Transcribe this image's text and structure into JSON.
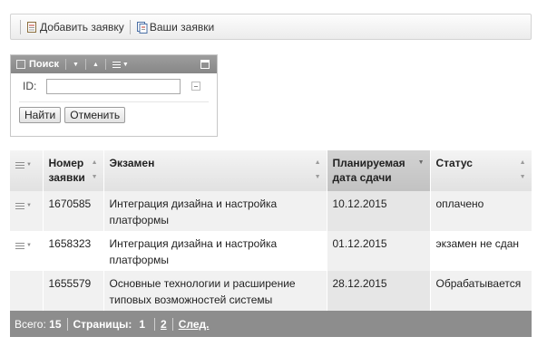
{
  "toolbar": {
    "add_label": "Добавить заявку",
    "mine_label": "Ваши заявки"
  },
  "search": {
    "title": "Поиск",
    "id_label": "ID:",
    "id_value": "",
    "find_label": "Найти",
    "cancel_label": "Отменить"
  },
  "grid": {
    "columns": {
      "number": "Номер заявки",
      "exam": "Экзамен",
      "date": "Планируемая дата сдачи",
      "status": "Статус"
    },
    "rows": [
      {
        "number": "1670585",
        "exam": "Интеграция дизайна и настройка платформы",
        "date": "10.12.2015",
        "status": "оплачено"
      },
      {
        "number": "1658323",
        "exam": "Интеграция дизайна и настройка платформы",
        "date": "01.12.2015",
        "status": "экзамен не сдан"
      },
      {
        "number": "1655579",
        "exam": "Основные технологии и расширение типовых возможностей системы",
        "date": "28.12.2015",
        "status": "Обрабатывается"
      }
    ]
  },
  "footer": {
    "total_label": "Всего:",
    "total_value": "15",
    "pages_label": "Страницы:",
    "current_page": "1",
    "page_2": "2",
    "next_label": "След."
  },
  "colors": {
    "panel_header": "#8d8d8d",
    "sorted_header": "#c7c7c7",
    "row_alt": "#f1f1f1"
  }
}
